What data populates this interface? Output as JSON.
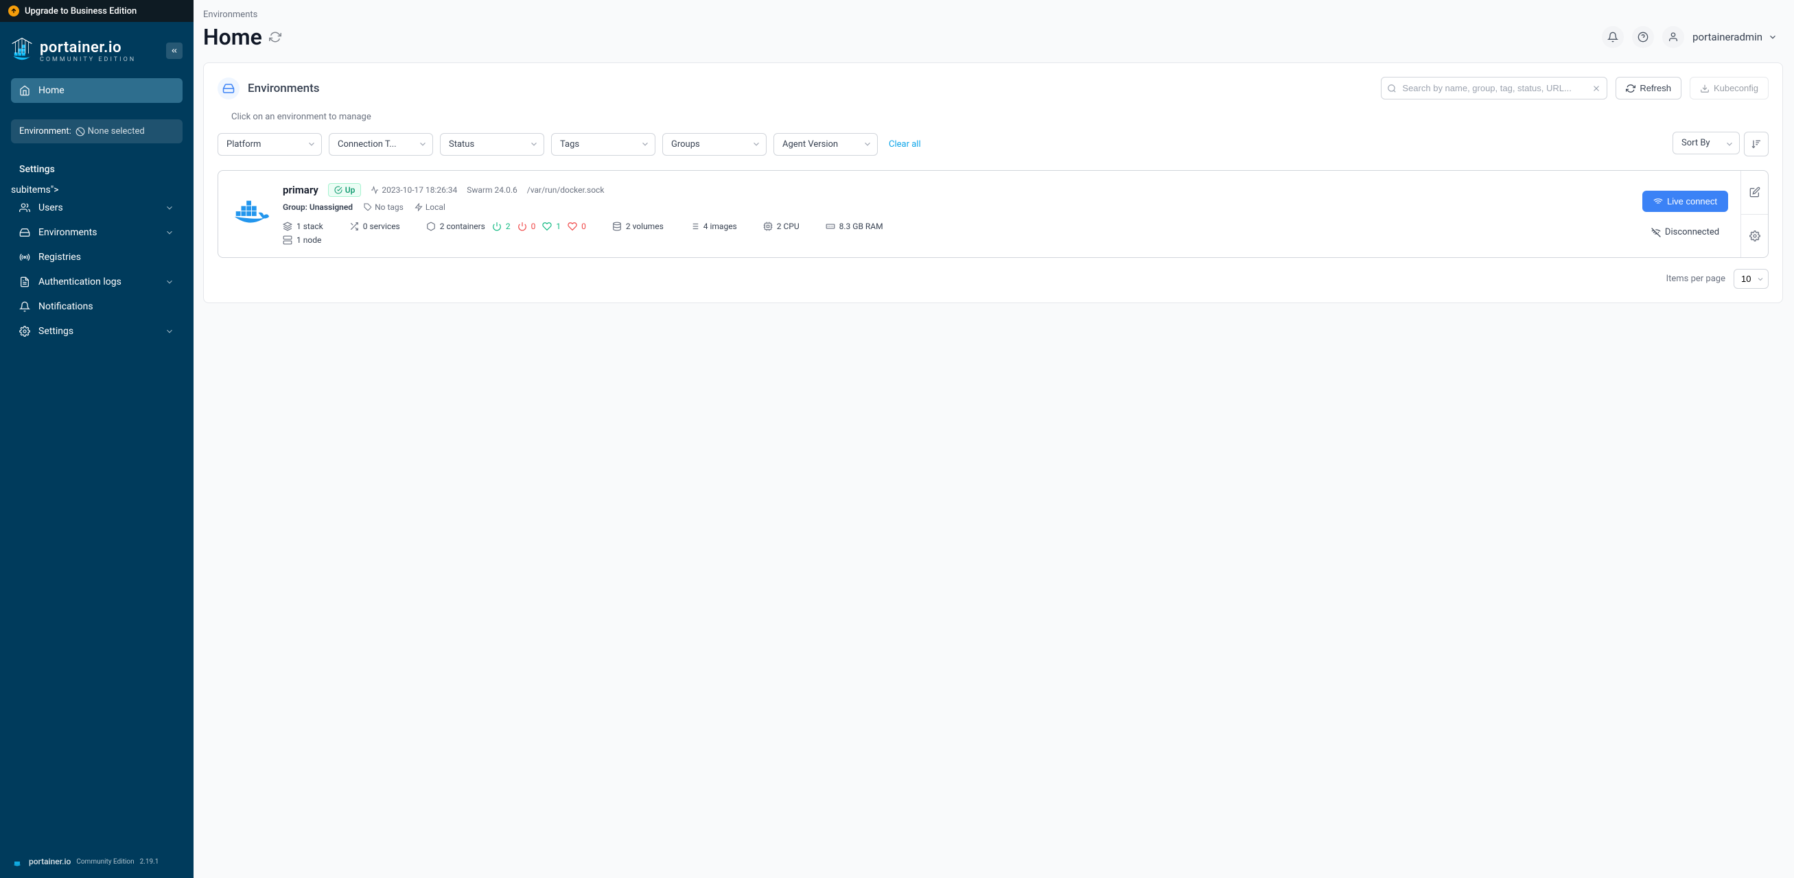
{
  "upgrade_banner": "Upgrade to Business Edition",
  "logo": {
    "main": "portainer.io",
    "sub": "COMMUNITY EDITION"
  },
  "nav": {
    "home": "Home",
    "env_label": "Environment:",
    "env_value": "None selected",
    "settings_label": "Settings",
    "items": [
      {
        "label": "Users"
      },
      {
        "label": "Environments"
      },
      {
        "label": "Registries"
      },
      {
        "label": "Authentication logs"
      },
      {
        "label": "Notifications"
      },
      {
        "label": "Settings"
      }
    ]
  },
  "footer": {
    "brand": "portainer.io",
    "edition": "Community Edition",
    "version": "2.19.1"
  },
  "breadcrumb": "Environments",
  "page_title": "Home",
  "user_menu": "portaineradmin",
  "panel": {
    "title": "Environments",
    "search_placeholder": "Search by name, group, tag, status, URL...",
    "refresh": "Refresh",
    "kubeconfig": "Kubeconfig",
    "hint": "Click on an environment to manage",
    "filters": {
      "platform": "Platform",
      "connection": "Connection T...",
      "status": "Status",
      "tags": "Tags",
      "groups": "Groups",
      "agent": "Agent Version",
      "clear": "Clear all",
      "sort": "Sort By"
    }
  },
  "env": {
    "name": "primary",
    "status": "Up",
    "timestamp": "2023-10-17 18:26:34",
    "platform": "Swarm 24.0.6",
    "socket": "/var/run/docker.sock",
    "group_label": "Group:",
    "group_value": "Unassigned",
    "tags": "No tags",
    "locality": "Local",
    "stats": {
      "stacks": "1 stack",
      "services": "0 services",
      "containers": "2 containers",
      "running": "2",
      "stopped": "0",
      "healthy": "1",
      "unhealthy": "0",
      "volumes": "2 volumes",
      "images": "4 images",
      "cpu": "2 CPU",
      "ram": "8.3 GB RAM",
      "nodes": "1 node"
    },
    "live_connect": "Live connect",
    "disconnected": "Disconnected"
  },
  "pager": {
    "label": "Items per page",
    "value": "10"
  }
}
